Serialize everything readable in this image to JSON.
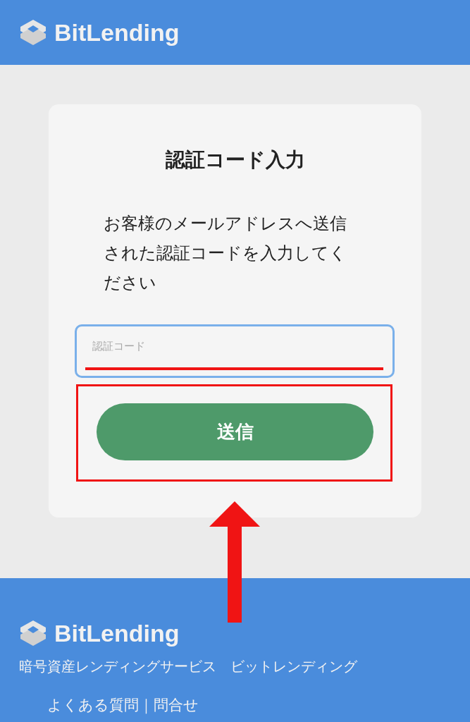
{
  "header": {
    "logo": "BitLending"
  },
  "card": {
    "title": "認証コード入力",
    "message": "お客様のメールアドレスへ送信された認証コードを入力してください",
    "field": {
      "placeholder": "認証コード"
    },
    "submit": "送信"
  },
  "footer": {
    "logo": "BitLending",
    "tagline": "暗号資産レンディングサービス　ビットレンディング",
    "links": "よくある質問｜問合せ"
  }
}
